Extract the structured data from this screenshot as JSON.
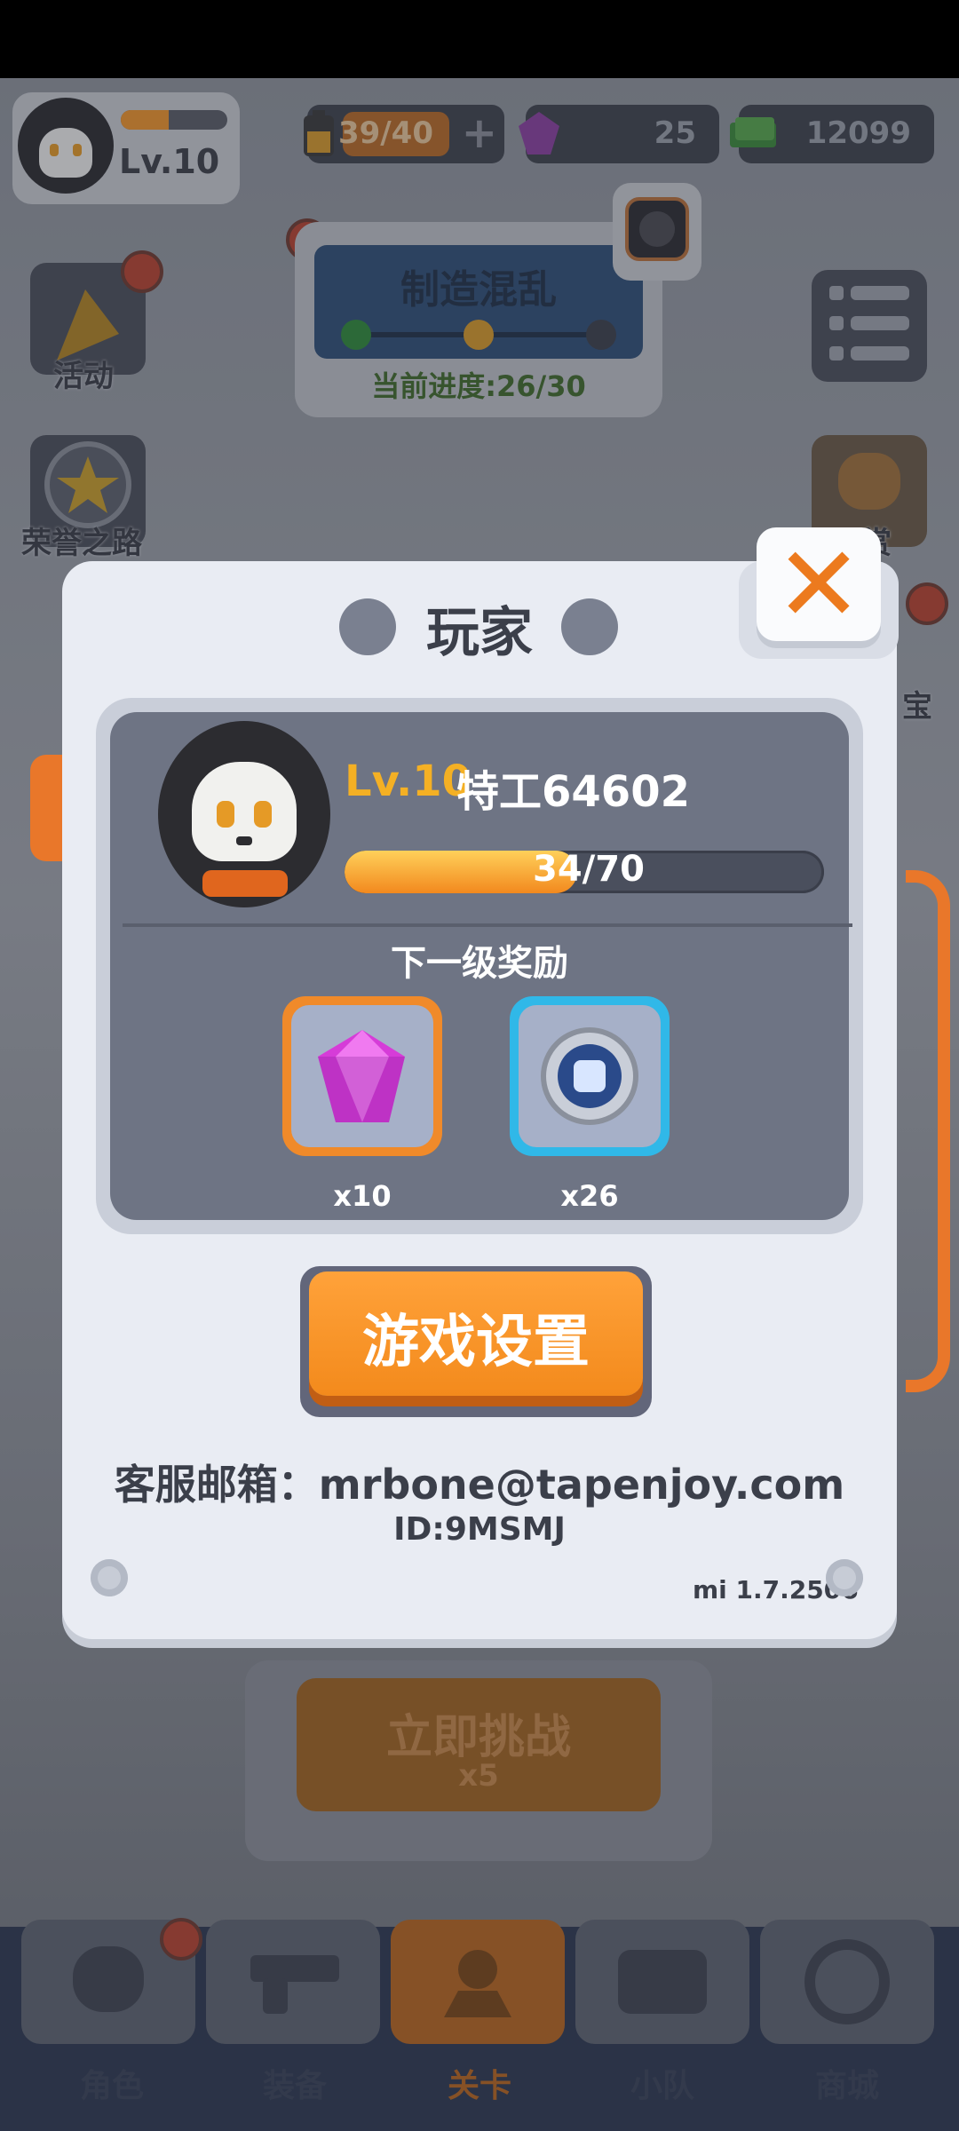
{
  "hud": {
    "player_level": "Lv.10",
    "energy": "39/40",
    "gems": "25",
    "cash": "12099"
  },
  "side_menu": {
    "events": "活动",
    "honor_road": "荣誉之路",
    "reward_partial": "赏",
    "treasure_partial": "宝"
  },
  "mission": {
    "title": "制造混乱",
    "progress": "当前进度:26/30"
  },
  "challenge": {
    "label": "立即挑战",
    "cost": "x5"
  },
  "tabs": [
    "角色",
    "装备",
    "关卡",
    "小队",
    "商城"
  ],
  "modal": {
    "title": "玩家",
    "close_icon": "close-x-icon",
    "player_level": "Lv.10",
    "player_name": "特工64602",
    "xp_text": "34/70",
    "xp_fraction": 0.486,
    "next_reward_title": "下一级奖励",
    "rewards": [
      {
        "icon": "gem-icon",
        "count": "x10"
      },
      {
        "icon": "fist-coin-icon",
        "count": "x26"
      }
    ],
    "settings_button": "游戏设置",
    "support_email": "客服邮箱：mrbone@tapenjoy.com",
    "player_id": "ID:9MSMJ",
    "version": "mi 1.7.2506"
  },
  "colors": {
    "accent_orange": "#f38a1c",
    "level_gold": "#f4b024",
    "panel_dark": "#6e7484"
  }
}
